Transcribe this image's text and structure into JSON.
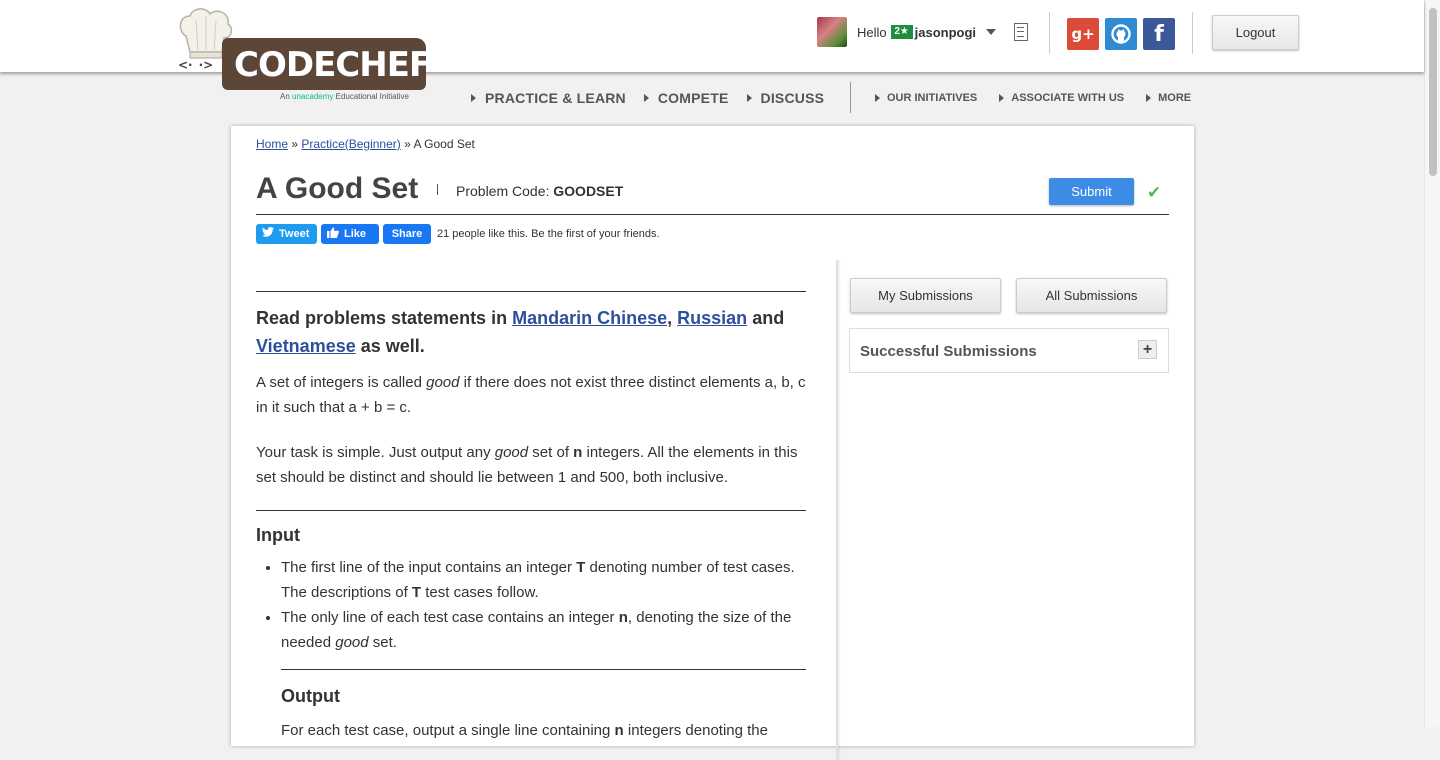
{
  "header": {
    "logo_text": "CODECHEF",
    "tagline_prefix": "An",
    "tagline_brand": "unacademy",
    "tagline_suffix": "Educational Initiative",
    "greeting": "Hello",
    "star_rating": "2★",
    "username": "jasonpogi",
    "logout_label": "Logout",
    "social": {
      "google": "g+",
      "facebook": "f"
    },
    "nav": {
      "practice": "PRACTICE & LEARN",
      "compete": "COMPETE",
      "discuss": "DISCUSS",
      "initiatives": "OUR INITIATIVES",
      "associate": "ASSOCIATE WITH US",
      "more": "MORE"
    }
  },
  "breadcrumb": {
    "home": "Home",
    "sep1": "»",
    "practice": "Practice(Beginner)",
    "sep2": "»",
    "current": "A Good Set"
  },
  "problem": {
    "title": "A Good Set",
    "code_label": "Problem Code:",
    "code": "GOODSET",
    "submit_label": "Submit"
  },
  "share": {
    "tweet": "Tweet",
    "like": "Like",
    "share": "Share",
    "like_text": "21 people like this. Be the first of your friends."
  },
  "statement": {
    "lang_prefix": "Read problems statements in",
    "lang1": "Mandarin Chinese",
    "comma": ",",
    "lang2": "Russian",
    "and": "and",
    "lang3": "Vietnamese",
    "lang_suffix": "as well.",
    "p1_a": "A set of integers is called",
    "p1_good": "good",
    "p1_b": "if there does not exist three distinct elements a, b, c in it such that a + b = c.",
    "p2_a": "Your task is simple. Just output any",
    "p2_good": "good",
    "p2_b": "set of",
    "p2_n": "n",
    "p2_c": "integers. All the elements in this set should be distinct and should lie between 1 and 500, both inclusive.",
    "input_heading": "Input",
    "input_items": [
      {
        "a": "The first line of the input contains an integer",
        "b": "T",
        "c": "denoting number of test cases. The descriptions of",
        "d": "T",
        "e": "test cases follow."
      },
      {
        "a": "The only line of each test case contains an integer",
        "b": "n",
        "c": ", denoting the size of the needed",
        "d": "good",
        "e": "set."
      }
    ],
    "output_heading": "Output",
    "output_a": "For each test case, output a single line containing",
    "output_n": "n",
    "output_b": "integers denoting the"
  },
  "sidebar": {
    "my_submissions": "My Submissions",
    "all_submissions": "All Submissions",
    "successful_submissions": "Successful Submissions",
    "expand": "+"
  },
  "colors": {
    "accent_blue": "#3c8ce6",
    "link": "#2e4f9e",
    "success_check": "#5cb85c",
    "logo_brown": "#5b4638"
  }
}
